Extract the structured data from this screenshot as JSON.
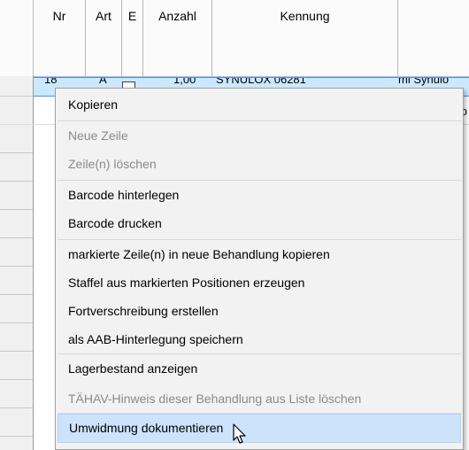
{
  "table": {
    "columns": [
      "Nr",
      "Art",
      "E",
      "Anzahl",
      "Kennung"
    ],
    "selected_row": {
      "nr": "18",
      "art": "A",
      "anzahl": "1,00",
      "kennung": "SYNULOX 06281",
      "extra": "ml Synulo"
    },
    "row2_extra": "o"
  },
  "menu": {
    "items": [
      {
        "label": "Kopieren",
        "enabled": true
      },
      {
        "label": "Neue Zeile",
        "enabled": false
      },
      {
        "label": "Zeile(n) löschen",
        "enabled": false
      },
      {
        "label": "Barcode hinterlegen",
        "enabled": true
      },
      {
        "label": "Barcode drucken",
        "enabled": true
      },
      {
        "label": "markierte Zeile(n) in neue Behandlung kopieren",
        "enabled": true
      },
      {
        "label": "Staffel aus markierten Positionen erzeugen",
        "enabled": true
      },
      {
        "label": "Fortverschreibung erstellen",
        "enabled": true
      },
      {
        "label": "als AAB-Hinterlegung speichern",
        "enabled": true
      },
      {
        "label": "Lagerbestand anzeigen",
        "enabled": true
      },
      {
        "label": "TÄHAV-Hinweis dieser Behandlung aus Liste löschen",
        "enabled": false
      },
      {
        "label": "Umwidmung dokumentieren",
        "enabled": true,
        "hovered": true
      }
    ]
  },
  "colors": {
    "menu_bg": "#f2f2f2",
    "hover": "#cde2fb",
    "selection": "#cce8ff",
    "disabled_text": "#8a8a8a"
  }
}
